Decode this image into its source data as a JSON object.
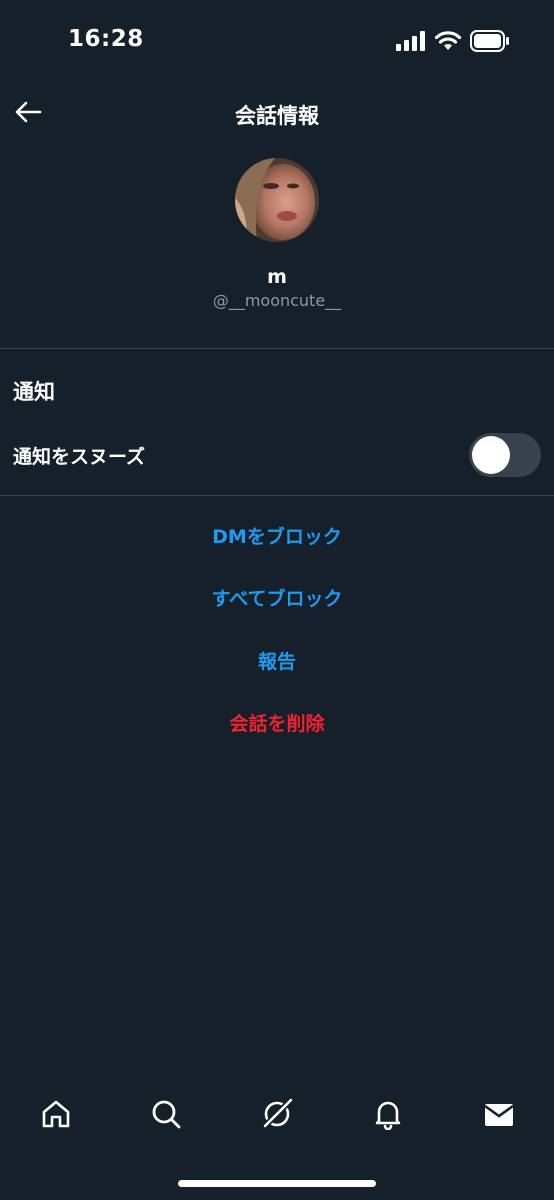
{
  "status_bar": {
    "time": "16:28",
    "icons": [
      "signal-icon",
      "wifi-icon",
      "battery-icon"
    ]
  },
  "header": {
    "title": "会話情報",
    "back_icon": "back-arrow-icon"
  },
  "profile": {
    "name": "m",
    "handle": "@__mooncute__"
  },
  "notifications": {
    "section_title": "通知",
    "snooze_label": "通知をスヌーズ",
    "snooze_enabled": false
  },
  "actions": {
    "block_dm": "DMをブロック",
    "block_all": "すべてブロック",
    "report": "報告",
    "delete_conversation": "会話を削除"
  },
  "bottom_nav": {
    "items": [
      "home-icon",
      "search-icon",
      "grok-icon",
      "notifications-bell-icon",
      "messages-mail-icon"
    ]
  },
  "colors": {
    "background": "#15202b",
    "accent": "#1d9bf0",
    "danger": "#f4212e",
    "secondary_text": "#8b98a5",
    "divider": "#38444d"
  }
}
